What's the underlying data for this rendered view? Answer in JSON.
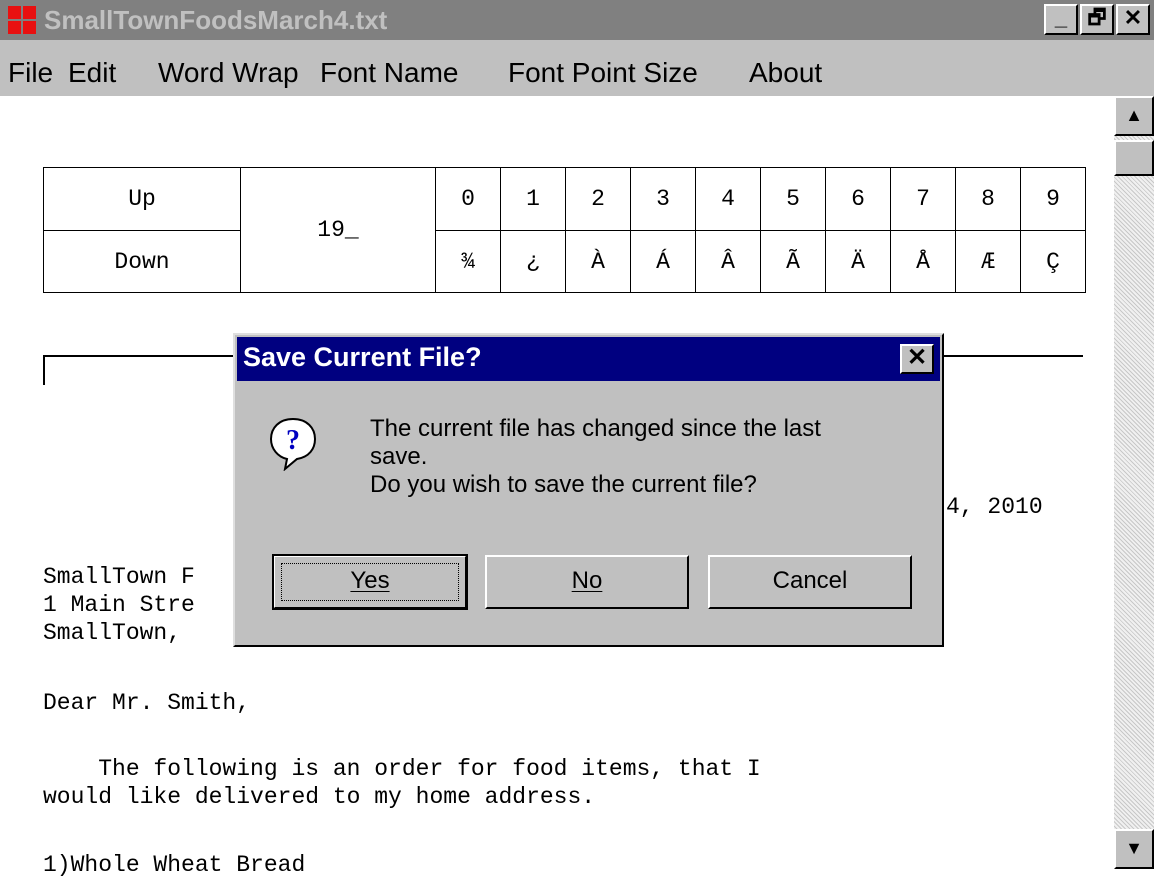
{
  "window": {
    "title": "SmallTownFoodsMarch4.txt",
    "buttons": {
      "minimize": "_",
      "restore": "🗗",
      "close": "✕"
    }
  },
  "menu": {
    "file": "File",
    "edit": "Edit",
    "word_wrap": "Word Wrap",
    "font_name": "Font Name",
    "font_point_size": "Font Point Size",
    "about": "About"
  },
  "char_table": {
    "up_label": "Up",
    "down_label": "Down",
    "code": "19_",
    "digits": [
      "0",
      "1",
      "2",
      "3",
      "4",
      "5",
      "6",
      "7",
      "8",
      "9"
    ],
    "chars": [
      "¾",
      "¿",
      "À",
      "Á",
      "Â",
      "Ã",
      "Ä",
      "Å",
      "Æ",
      "Ç"
    ]
  },
  "document": {
    "date_fragment": "4, 2010",
    "addr1": "SmallTown F",
    "addr2": "1 Main Stre",
    "addr3": "SmallTown,",
    "salutation": "Dear Mr. Smith,",
    "body1": "    The following is an order for food items, that I",
    "body2": "would like delivered to my home address.",
    "item1": "1)Whole Wheat Bread"
  },
  "dialog": {
    "title": "Save Current File?",
    "close": "✕",
    "message_line1": "The current file has changed since the last",
    "message_line2": "save.",
    "message_line3": "Do you wish to save the current file?",
    "yes": "Yes",
    "no": "No",
    "cancel": "Cancel"
  },
  "scrollbar": {
    "up": "▲",
    "down": "▼"
  }
}
